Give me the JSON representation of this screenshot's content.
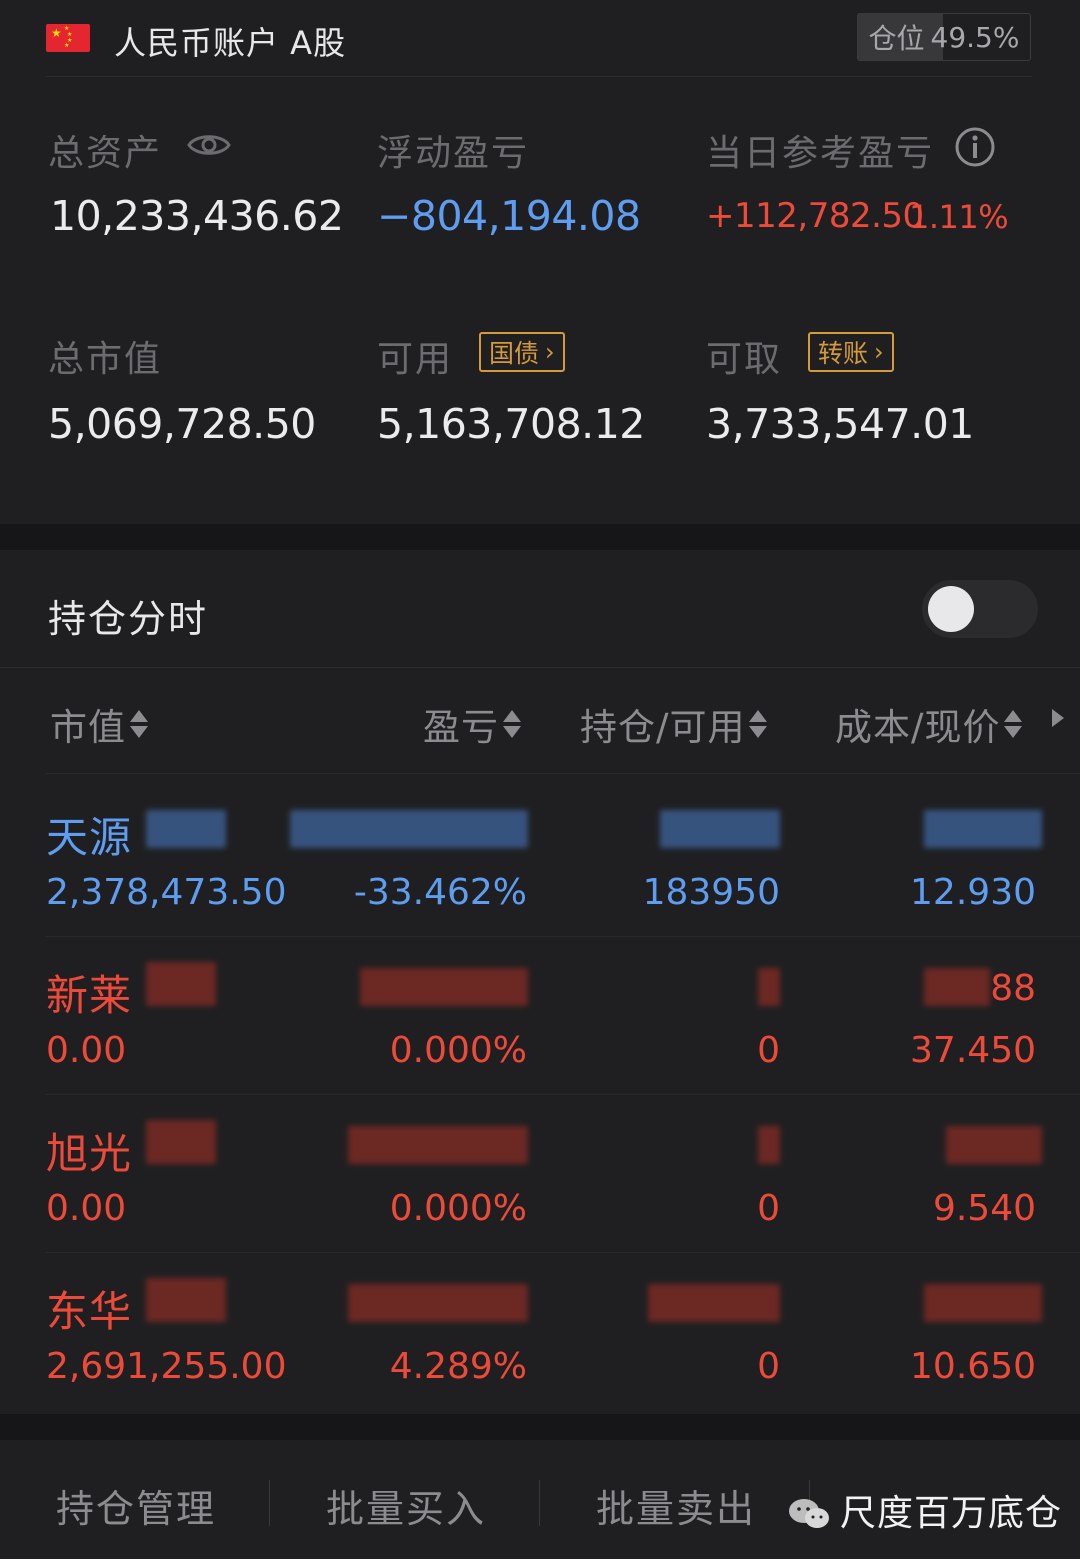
{
  "header": {
    "account_title": "人民币账户 A股",
    "position_label": "仓位",
    "position_value": "49.5%",
    "position_fraction": 0.495
  },
  "summary": {
    "total_assets_label": "总资产",
    "total_assets": "10,233,436.62",
    "floating_pl_label": "浮动盈亏",
    "floating_pl": "−804,194.08",
    "daily_pl_label": "当日参考盈亏",
    "daily_pl": "+112,782.50",
    "daily_pl_pct": "1.11%",
    "market_value_label": "总市值",
    "market_value": "5,069,728.50",
    "available_label": "可用",
    "available_tag": "国债",
    "available": "5,163,708.12",
    "withdrawable_label": "可取",
    "withdrawable_tag": "转账",
    "withdrawable": "3,733,547.01"
  },
  "holdings": {
    "section_title": "持仓分时",
    "toggle_on": false,
    "columns": [
      "市值",
      "盈亏",
      "持仓/可用",
      "成本/现价"
    ],
    "rows": [
      {
        "name": "天源",
        "market_value": "2,378,473.50",
        "pl_pct": "-33.462%",
        "qty": "183950",
        "price": "12.930",
        "cost_partial": "",
        "color": "#5e9df0"
      },
      {
        "name": "新莱",
        "market_value": "0.00",
        "pl_pct": "0.000%",
        "qty": "0",
        "price": "37.450",
        "cost_partial": "88",
        "color": "#ee4a3a"
      },
      {
        "name": "旭光",
        "market_value": "0.00",
        "pl_pct": "0.000%",
        "qty": "0",
        "price": "9.540",
        "cost_partial": "",
        "color": "#ee4a3a"
      },
      {
        "name": "东华",
        "market_value": "2,691,255.00",
        "pl_pct": "4.289%",
        "qty": "0",
        "price": "10.650",
        "cost_partial": "",
        "color": "#ee4a3a"
      }
    ]
  },
  "footer": {
    "items": [
      "持仓管理",
      "批量买入",
      "批量卖出"
    ],
    "watermark": "尺度百万底仓"
  },
  "colors": {
    "up": "#ee4a3a",
    "down": "#5e9df0",
    "tag": "#d49a3c",
    "background": "#1f1f21"
  }
}
